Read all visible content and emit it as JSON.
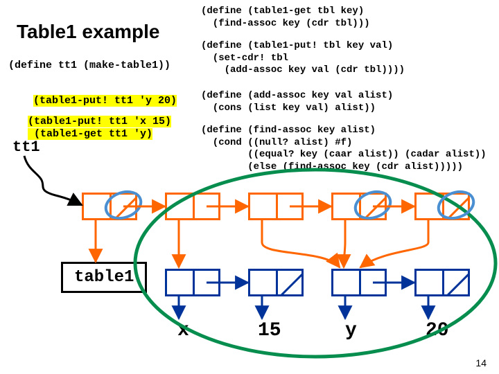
{
  "title": "Table1 example",
  "code_left": {
    "l1": "(define tt1 (make-table1))",
    "l2": "(table1-put! tt1 'y 20)",
    "l3": "(table1-put! tt1 'x 15)",
    "l4": " (table1-get tt1 'y)"
  },
  "code_right": {
    "get": "(define (table1-get tbl key)\n  (find-assoc key (cdr tbl)))",
    "put": "(define (table1-put! tbl key val)\n  (set-cdr! tbl\n    (add-assoc key val (cdr tbl))))",
    "add": "(define (add-assoc key val alist)\n  (cons (list key val) alist))",
    "find": "(define (find-assoc key alist)\n  (cond ((null? alist) #f)\n        ((equal? key (caar alist)) (cadar alist))\n        (else (find-assoc key (cdr alist)))))"
  },
  "labels": {
    "tt1": "tt1",
    "table1": "table1",
    "x": "x",
    "v15": "15",
    "y": "y",
    "v20": "20"
  },
  "pagenum": "14",
  "colors": {
    "orange": "#ff6600",
    "navy": "#003399",
    "green": "#078d4e",
    "blue": "#4a8fd1"
  }
}
